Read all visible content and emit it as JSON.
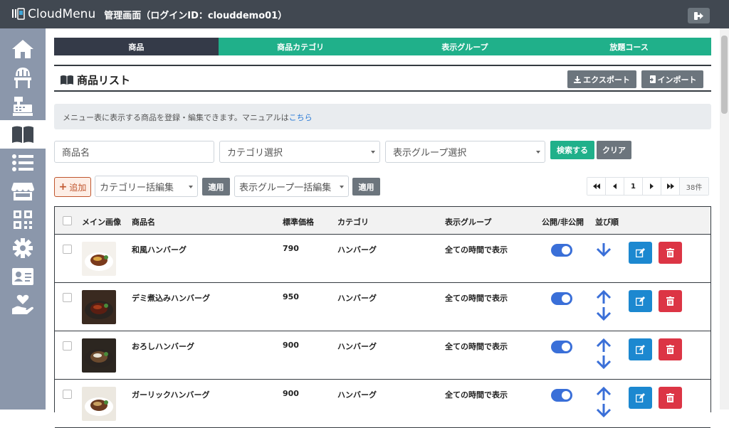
{
  "header": {
    "brand": "CloudMenu",
    "admin_title": "管理画面（ログインID：clouddemo01）"
  },
  "sidebar": {
    "items": [
      {
        "icon": "home-icon"
      },
      {
        "icon": "chair-icon"
      },
      {
        "icon": "register-icon"
      },
      {
        "icon": "book-icon",
        "active": true
      },
      {
        "icon": "list-icon"
      },
      {
        "icon": "store-icon"
      },
      {
        "icon": "qr-icon"
      },
      {
        "icon": "gear-icon"
      },
      {
        "icon": "id-card-icon"
      },
      {
        "icon": "hand-heart-icon"
      }
    ]
  },
  "tabs": [
    {
      "label": "商品",
      "active": true
    },
    {
      "label": "商品カテゴリ"
    },
    {
      "label": "表示グループ"
    },
    {
      "label": "放題コース"
    }
  ],
  "page": {
    "title": "商品リスト",
    "export_label": "エクスポート",
    "import_label": "インポート"
  },
  "info": {
    "text": "メニュー表に表示する商品を登録・編集できます。マニュアルは",
    "link": "こちら"
  },
  "search": {
    "name_placeholder": "商品名",
    "category_select": "カテゴリ選択",
    "group_select": "表示グループ選択",
    "search_label": "検索する",
    "clear_label": "クリア"
  },
  "bulk": {
    "add_label": "追加",
    "category_bulk": "カテゴリー括編集",
    "apply1": "適用",
    "group_bulk": "表示グループ一括編集",
    "apply2": "適用"
  },
  "pager": {
    "page": "1",
    "count": "38件"
  },
  "table": {
    "headers": {
      "image": "メイン画像",
      "name": "商品名",
      "price": "標準価格",
      "category": "カテゴリ",
      "group": "表示グループ",
      "public": "公開/非公開",
      "order": "並び順"
    },
    "rows": [
      {
        "name": "和風ハンバーグ",
        "price": "790",
        "category": "ハンバーグ",
        "group": "全ての時間で表示",
        "public": true,
        "order": "down"
      },
      {
        "name": "デミ煮込みハンバーグ",
        "price": "950",
        "category": "ハンバーグ",
        "group": "全ての時間で表示",
        "public": true,
        "order": "both"
      },
      {
        "name": "おろしハンバーグ",
        "price": "900",
        "category": "ハンバーグ",
        "group": "全ての時間で表示",
        "public": true,
        "order": "both"
      },
      {
        "name": "ガーリックハンバーグ",
        "price": "900",
        "category": "ハンバーグ",
        "group": "全ての時間で表示",
        "public": true,
        "order": "both"
      }
    ]
  },
  "colors": {
    "topbar": "#414851",
    "sidebar": "#8b97ab",
    "accent_green": "#20b08a",
    "toggle_blue": "#3a6fd8",
    "edit_blue": "#1c88d0",
    "delete_red": "#dc3545"
  }
}
